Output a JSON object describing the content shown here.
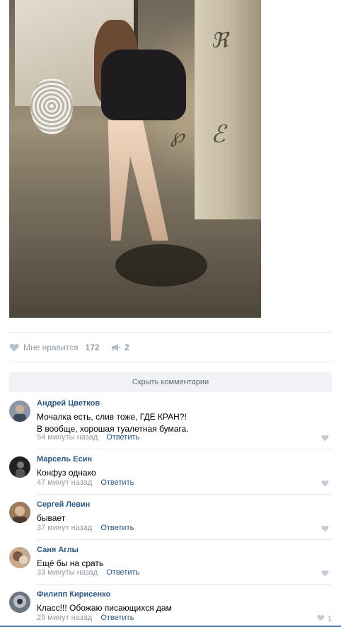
{
  "post": {
    "photo_alt": "",
    "likes_label": "Мне нравится",
    "likes_count": "172",
    "shares_count": "2",
    "hide_comments_label": "Скрыть комментарии"
  },
  "comments": [
    {
      "author": "Андрей Цветков",
      "text": "Мочалка есть, слив тоже, ГДЕ КРАН?!\nВ вообще, хорошая туалетная бумага.",
      "time": "54 минуты назад",
      "reply": "Ответить",
      "likes": ""
    },
    {
      "author": "Марсель Есин",
      "text": "Конфуз однако",
      "time": "47 минут назад",
      "reply": "Ответить",
      "likes": ""
    },
    {
      "author": "Сергей Левин",
      "text": "бывает",
      "time": "37 минут назад",
      "reply": "Ответить",
      "likes": ""
    },
    {
      "author": "Саня Аглы",
      "text": "Ещё бы на срать",
      "time": "33 минуты назад",
      "reply": "Ответить",
      "likes": ""
    },
    {
      "author": "Филипп Кирисенко",
      "text": "Класс!!! Обожаю писающихся дам",
      "time": "29 минут назад",
      "reply": "Ответить",
      "likes": "1"
    }
  ],
  "colors": {
    "link": "#2a5885",
    "muted": "#939da8",
    "button_bg": "#f0f2f5"
  },
  "icons": {
    "like": "heart-icon",
    "share": "megaphone-icon"
  }
}
